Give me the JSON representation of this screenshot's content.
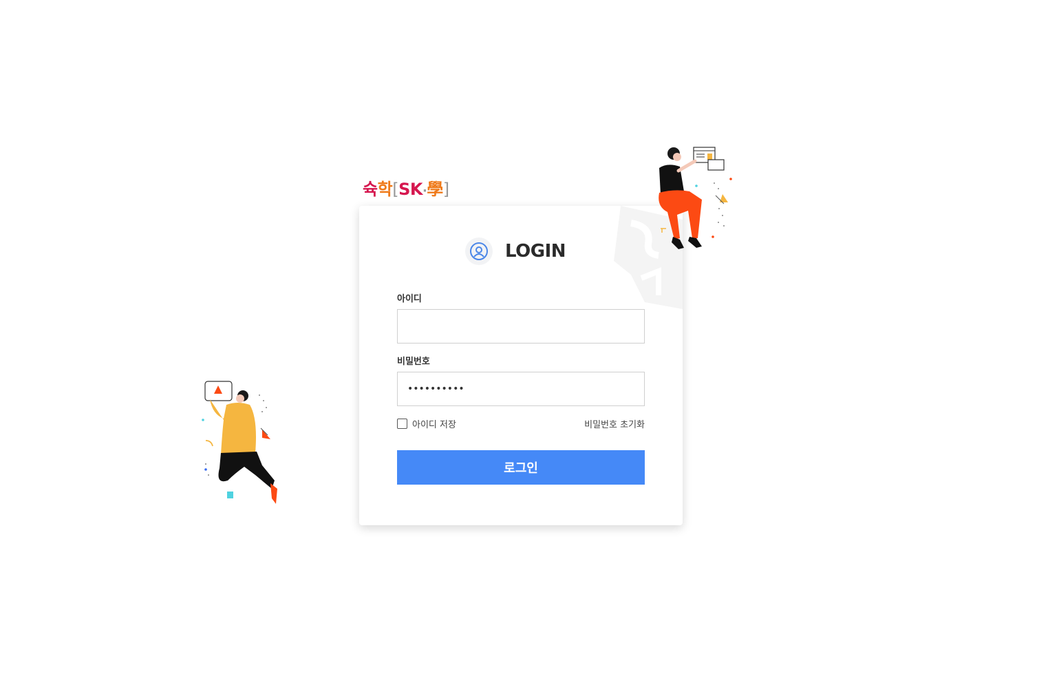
{
  "logo": {
    "part1": "슉",
    "part2": "학",
    "bracket_open": "[",
    "part3": "SK",
    "dot": "·",
    "part4": "學",
    "bracket_close": "]"
  },
  "login": {
    "title": "LOGIN"
  },
  "form": {
    "id_label": "아이디",
    "id_value": "",
    "password_label": "비밀번호",
    "password_value": "••••••••••",
    "remember_label": "아이디 저장",
    "reset_link": "비밀번호 초기화",
    "submit_label": "로그인"
  },
  "colors": {
    "primary": "#4589f7",
    "logo_red": "#d6174f",
    "logo_orange": "#ef7a1a"
  },
  "icons": {
    "user": "user-circle-icon"
  }
}
